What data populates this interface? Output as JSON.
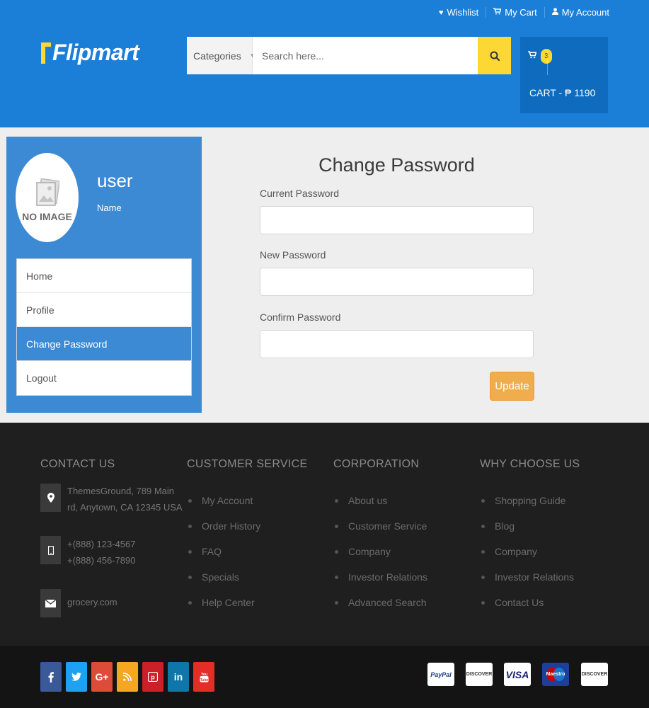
{
  "header": {
    "links": [
      {
        "label": "Wishlist",
        "icon": "heart-icon"
      },
      {
        "label": "My Cart",
        "icon": "cart-icon"
      },
      {
        "label": "My Account",
        "icon": "user-icon"
      }
    ],
    "logo_text": "Flipmart",
    "search": {
      "category_label": "Categories",
      "placeholder": "Search here..."
    },
    "cart": {
      "count": "3",
      "total_label": "CART - ₱ 1190"
    }
  },
  "sidebar": {
    "avatar_text": "NO IMAGE",
    "user_name": "user",
    "user_sub": "Name",
    "menu": [
      {
        "label": "Home"
      },
      {
        "label": "Profile"
      },
      {
        "label": "Change Password",
        "active": true
      },
      {
        "label": "Logout"
      }
    ]
  },
  "form": {
    "title": "Change Password",
    "current_label": "Current Password",
    "new_label": "New Password",
    "confirm_label": "Confirm Password",
    "submit_label": "Update"
  },
  "footer": {
    "contact": {
      "title": "CONTACT US",
      "address_line1": "ThemesGround, 789 Main",
      "address_line2": "rd, Anytown, CA 12345 USA",
      "phone1": "+(888) 123-4567",
      "phone2": "+(888) 456-7890",
      "email": "grocery.com"
    },
    "customer_service": {
      "title": "CUSTOMER SERVICE",
      "items": [
        "My Account",
        "Order History",
        "FAQ",
        "Specials",
        "Help Center"
      ]
    },
    "corporation": {
      "title": "CORPORATION",
      "items": [
        "About us",
        "Customer Service",
        "Company",
        "Investor Relations",
        "Advanced Search"
      ]
    },
    "why_choose_us": {
      "title": "WHY CHOOSE US",
      "items": [
        "Shopping Guide",
        "Blog",
        "Company",
        "Investor Relations",
        "Contact Us"
      ]
    }
  },
  "bottom": {
    "social": [
      {
        "name": "facebook-icon",
        "glyph": "f",
        "color": "#3b5998"
      },
      {
        "name": "twitter-icon",
        "glyph": "t",
        "color": "#1da1f2"
      },
      {
        "name": "google-plus-icon",
        "glyph": "G+",
        "color": "#dd4b39"
      },
      {
        "name": "rss-icon",
        "glyph": "rss",
        "color": "#f5a623"
      },
      {
        "name": "pinterest-icon",
        "glyph": "p",
        "color": "#cb2027"
      },
      {
        "name": "linkedin-icon",
        "glyph": "in",
        "color": "#0e76a8"
      },
      {
        "name": "youtube-icon",
        "glyph": "yt",
        "color": "#e52d27"
      }
    ],
    "payments": [
      {
        "name": "paypal-logo",
        "label": "PayPal"
      },
      {
        "name": "discover-logo",
        "label": "DISCOVER"
      },
      {
        "name": "visa-logo",
        "label": "VISA"
      },
      {
        "name": "maestro-logo",
        "label": "Maestro"
      },
      {
        "name": "discover-logo-2",
        "label": "DISCOVER"
      }
    ]
  }
}
